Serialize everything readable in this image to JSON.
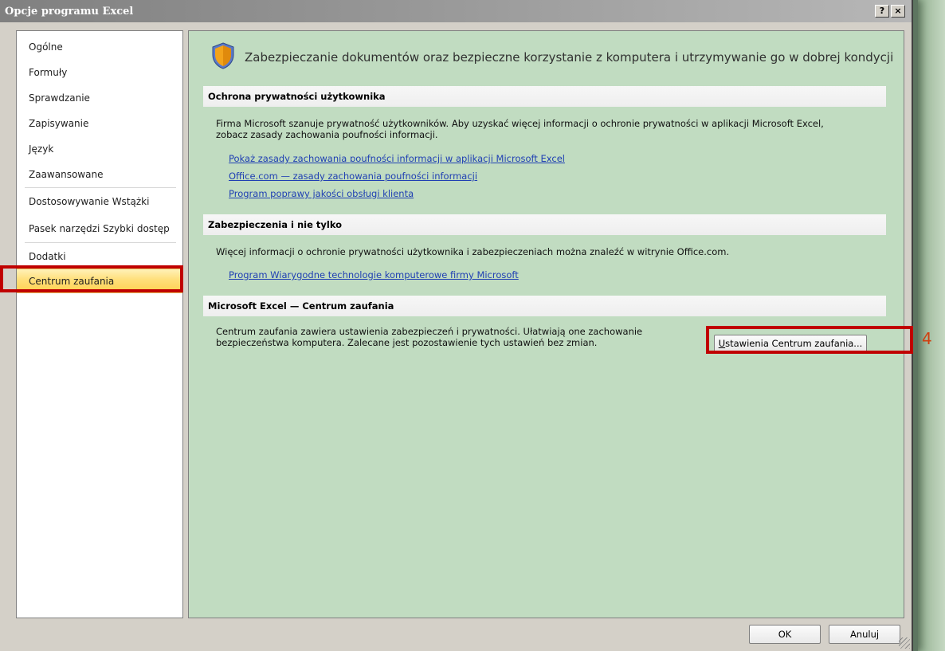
{
  "window": {
    "title": "Opcje programu Excel",
    "help_btn": "?",
    "close_btn": "×"
  },
  "sidebar": {
    "items": [
      {
        "label": "Ogólne"
      },
      {
        "label": "Formuły"
      },
      {
        "label": "Sprawdzanie"
      },
      {
        "label": "Zapisywanie"
      },
      {
        "label": "Język"
      },
      {
        "label": "Zaawansowane"
      },
      {
        "label": "Dostosowywanie Wstążki"
      },
      {
        "label": "Pasek narzędzi Szybki dostęp"
      },
      {
        "label": "Dodatki"
      },
      {
        "label": "Centrum zaufania"
      }
    ],
    "selected": "Centrum zaufania"
  },
  "main": {
    "header": "Zabezpieczanie dokumentów oraz bezpieczne korzystanie z komputera i utrzymywanie go w dobrej kondycji",
    "sections": [
      {
        "title": "Ochrona prywatności użytkownika",
        "text_line1": "Firma Microsoft szanuje prywatność użytkowników. Aby uzyskać więcej informacji o ochronie prywatności w aplikacji Microsoft Excel,",
        "text_line2": "zobacz zasady zachowania poufności informacji.",
        "links": [
          "Pokaż zasady zachowania poufności informacji w aplikacji Microsoft Excel",
          "Office.com — zasady zachowania poufności informacji",
          "Program poprawy jakości obsługi klienta"
        ]
      },
      {
        "title": "Zabezpieczenia i nie tylko",
        "text_line1": "Więcej informacji o ochronie prywatności użytkownika i zabezpieczeniach można znaleźć w witrynie Office.com.",
        "links": [
          "Program Wiarygodne technologie komputerowe firmy Microsoft"
        ]
      },
      {
        "title": "Microsoft Excel — Centrum zaufania",
        "text_line1": "Centrum zaufania zawiera ustawienia zabezpieczeń i prywatności. Ułatwiają one zachowanie",
        "text_line2": "bezpieczeństwa komputera. Zalecane jest pozostawienie tych ustawień bez zmian.",
        "button_mnemonic": "U",
        "button_rest": "stawienia Centrum zaufania..."
      }
    ]
  },
  "annotation": {
    "step_number": "4",
    "color": "#c00000"
  },
  "footer": {
    "ok": "OK",
    "cancel": "Anuluj"
  }
}
